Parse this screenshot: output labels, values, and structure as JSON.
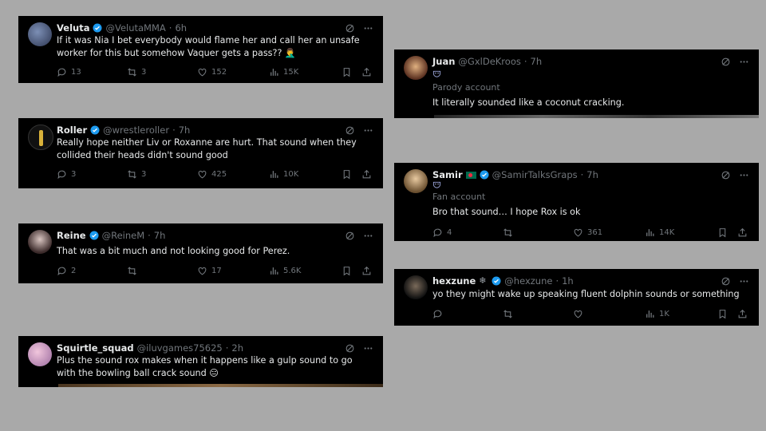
{
  "tweets": [
    {
      "id": "veluta",
      "name": "Veluta",
      "handle": "@VelutaMMA",
      "time": "6h",
      "verified": true,
      "text": "If it was Nia I bet everybody would flame her and call her an unsafe worker for this but somehow Vaquer gets a pass?? 🤦‍♂️",
      "replies": "13",
      "reposts": "3",
      "likes": "152",
      "views": "15K",
      "avatar_color": "#3a4a6b"
    },
    {
      "id": "roller",
      "name": "Roller",
      "handle": "@wrestleroller",
      "time": "7h",
      "verified": true,
      "text": "Really hope neither Liv or Roxanne are hurt. That sound when they collided their heads didn't sound good",
      "replies": "3",
      "reposts": "3",
      "likes": "425",
      "views": "10K",
      "avatar_color": "#111"
    },
    {
      "id": "reine",
      "name": "Reine",
      "handle": "@ReineM",
      "time": "7h",
      "verified": true,
      "text": "That was a bit much and not looking good for Perez.",
      "replies": "2",
      "reposts": "",
      "likes": "17",
      "views": "5.6K",
      "avatar_color": "#555"
    },
    {
      "id": "squirtle",
      "name": "Squirtle_squad",
      "handle": "@iluvgames75625",
      "time": "2h",
      "verified": false,
      "text": "Plus the sound rox makes when it happens like a gulp sound to go with the bowling ball crack sound 😑",
      "avatar_color": "#c98ab0"
    },
    {
      "id": "juan",
      "name": "Juan",
      "handle": "@GxlDeKroos",
      "time": "7h",
      "verified": false,
      "label": "Parody account",
      "text": "It literally sounded like a coconut cracking.",
      "avatar_color": "#6b4a3a"
    },
    {
      "id": "samir",
      "name": "Samir",
      "handle": "@SamirTalksGraps",
      "time": "7h",
      "verified": true,
      "label": "Fan account",
      "text": "Bro that sound… I hope Rox is ok",
      "replies": "4",
      "reposts": "",
      "likes": "361",
      "views": "14K",
      "avatar_color": "#c9a57a"
    },
    {
      "id": "hexzune",
      "name": "hexzune",
      "handle": "@hexzune",
      "time": "1h",
      "verified": true,
      "text": "yo they might wake up speaking fluent dolphin sounds or something",
      "replies": "",
      "reposts": "",
      "likes": "",
      "views": "1K",
      "avatar_color": "#2a2a2a"
    }
  ],
  "colors": {
    "verified": "#1d9bf0",
    "muted": "#71767b",
    "text": "#e7e9ea"
  }
}
